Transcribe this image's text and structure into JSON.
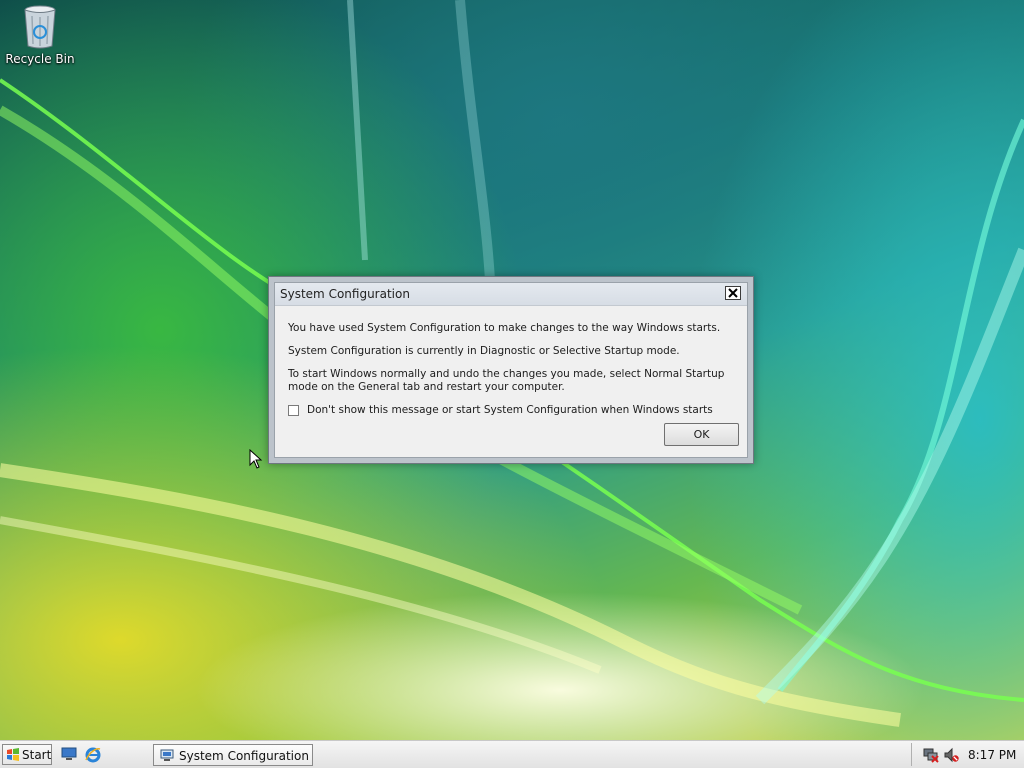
{
  "desktop": {
    "icons": [
      {
        "label": "Recycle Bin",
        "icon": "recycle-bin-icon"
      }
    ]
  },
  "dialog": {
    "title": "System Configuration",
    "close_icon": "close-icon",
    "line1": "You have used System Configuration to make changes to the way Windows starts.",
    "line2": "System Configuration is currently in Diagnostic or Selective Startup mode.",
    "line3": "To start Windows normally and undo the changes you made, select Normal Startup mode on the General tab and restart your computer.",
    "checkbox_label": "Don't show this message or start System Configuration when Windows starts",
    "checkbox_checked": false,
    "ok_label": "OK"
  },
  "taskbar": {
    "start_label": "Start",
    "quick_launch": [
      "show-desktop-icon",
      "internet-explorer-icon"
    ],
    "task_buttons": [
      {
        "label": "System Configuration",
        "icon": "system-configuration-icon"
      }
    ],
    "tray_icons": [
      "network-disconnected-icon",
      "volume-muted-icon"
    ],
    "clock": "8:17 PM"
  },
  "colors": {
    "dialog_face": "#f0f0f0",
    "dialog_frame": "#bcc3cb",
    "taskbar": "#ececec"
  }
}
